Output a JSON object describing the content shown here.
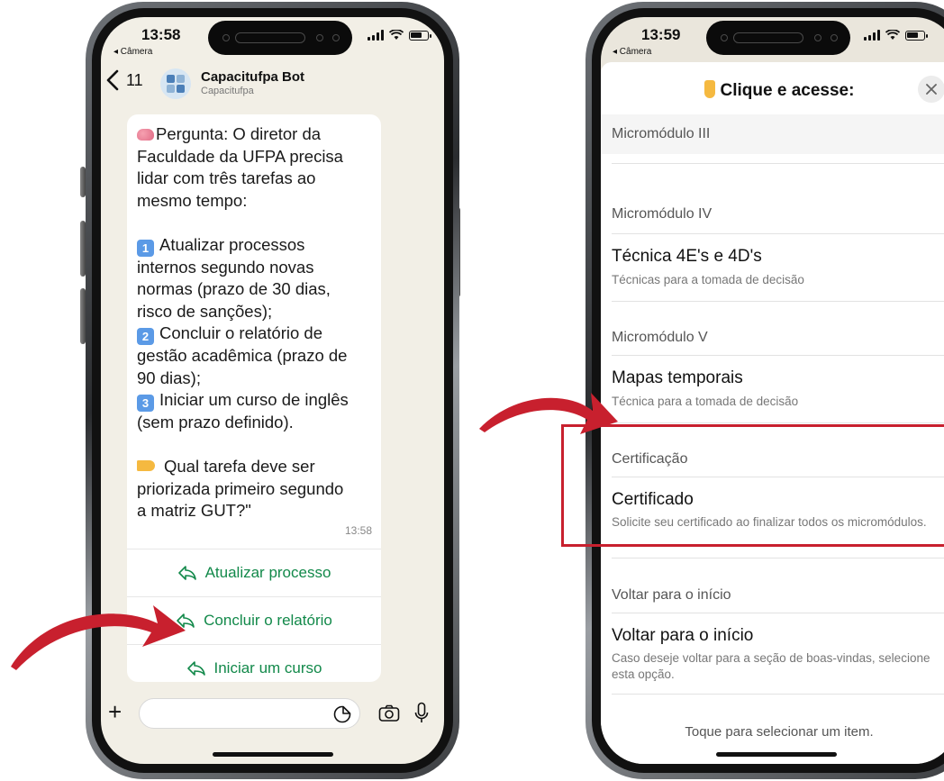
{
  "left_phone": {
    "status": {
      "time": "13:58",
      "back_label": "◂ Câmera"
    },
    "header": {
      "back_count": "11",
      "contact_name": "Capacitufpa Bot",
      "contact_sub": "Capacitufpa"
    },
    "message": {
      "lines": [
        "Pergunta: O diretor da",
        "Faculdade da UFPA precisa",
        "lidar com três tarefas ao",
        "mesmo tempo:",
        "Atualizar processos",
        "internos segundo novas",
        "normas (prazo de 30 dias,",
        "risco de sanções);",
        "Concluir o relatório de",
        "gestão acadêmica (prazo de",
        "90 dias);",
        "Iniciar um curso de inglês",
        "(sem prazo definido).",
        "Qual tarefa deve ser",
        "priorizada primeiro segundo",
        "a matriz GUT?\""
      ],
      "keycaps": [
        "1",
        "2",
        "3"
      ],
      "time": "13:58"
    },
    "reply_buttons": [
      {
        "label": "Atualizar processo"
      },
      {
        "label": "Concluir o relatório"
      },
      {
        "label": "Iniciar um curso"
      }
    ]
  },
  "right_phone": {
    "status": {
      "time": "13:59",
      "back_label": "◂ Câmera"
    },
    "sheet": {
      "title": "Clique e acesse:",
      "close_icon": "×",
      "sections": [
        {
          "header": "Micromódulo III"
        },
        {
          "header": "Micromódulo IV",
          "item_title": "Técnica 4E's e 4D's",
          "item_sub": "Técnicas para a tomada de decisão"
        },
        {
          "header": "Micromódulo V",
          "item_title": "Mapas temporais",
          "item_sub": "Técnica para a tomada de decisão"
        },
        {
          "header": "Certificação",
          "item_title": "Certificado",
          "item_sub": "Solicite seu certificado ao finalizar todos os micromódulos."
        },
        {
          "header": "Voltar para o início",
          "item_title": "Voltar para o início",
          "item_sub": "Caso deseje voltar para a seção de boas-vindas, selecione esta opção."
        }
      ],
      "footer": "Toque para selecionar um item."
    }
  },
  "colors": {
    "accent_green": "#12894a",
    "highlight_red": "#c8202e",
    "arrow_red": "#c8202e"
  }
}
